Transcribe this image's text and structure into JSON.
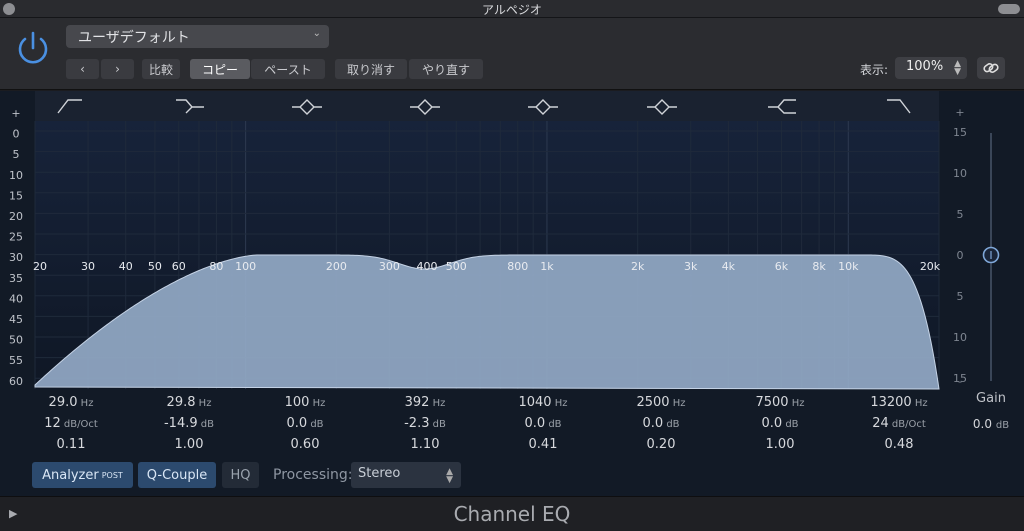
{
  "window": {
    "title": "アルペジオ"
  },
  "header": {
    "preset": "ユーザデフォルト",
    "compare": "比較",
    "copy": "コピー",
    "paste": "ペースト",
    "undo": "取り消す",
    "redo": "やり直す",
    "view_label": "表示:",
    "zoom": "100%"
  },
  "colors": {
    "accent": "#4a90e2",
    "curve_fill": "#93a9c6",
    "background": "#121a26"
  },
  "chart_data": {
    "type": "area",
    "x_scale": "log",
    "x_tick_labels": [
      "20",
      "30",
      "40",
      "50",
      "60",
      "80",
      "100",
      "200",
      "300",
      "400",
      "500",
      "800",
      "1k",
      "2k",
      "3k",
      "4k",
      "6k",
      "8k",
      "10k",
      "20k"
    ],
    "y_tick_labels_left": [
      "+",
      "0",
      "5",
      "10",
      "15",
      "20",
      "25",
      "30",
      "35",
      "40",
      "45",
      "50",
      "55",
      "60",
      "-"
    ],
    "y_tick_labels_right": [
      "+",
      "15",
      "10",
      "5",
      "0",
      "5",
      "10",
      "15",
      "-"
    ]
  },
  "bands": [
    {
      "freq": "29.0",
      "freq_unit": "Hz",
      "gain": "12",
      "gain_unit": "dB/Oct",
      "q": "0.11"
    },
    {
      "freq": "29.8",
      "freq_unit": "Hz",
      "gain": "-14.9",
      "gain_unit": "dB",
      "q": "1.00"
    },
    {
      "freq": "100",
      "freq_unit": "Hz",
      "gain": "0.0",
      "gain_unit": "dB",
      "q": "0.60"
    },
    {
      "freq": "392",
      "freq_unit": "Hz",
      "gain": "-2.3",
      "gain_unit": "dB",
      "q": "1.10"
    },
    {
      "freq": "1040",
      "freq_unit": "Hz",
      "gain": "0.0",
      "gain_unit": "dB",
      "q": "0.41"
    },
    {
      "freq": "2500",
      "freq_unit": "Hz",
      "gain": "0.0",
      "gain_unit": "dB",
      "q": "0.20"
    },
    {
      "freq": "7500",
      "freq_unit": "Hz",
      "gain": "0.0",
      "gain_unit": "dB",
      "q": "1.00"
    },
    {
      "freq": "13200",
      "freq_unit": "Hz",
      "gain": "24",
      "gain_unit": "dB/Oct",
      "q": "0.48"
    }
  ],
  "gain": {
    "label": "Gain",
    "value": "0.0",
    "unit": "dB"
  },
  "bottom": {
    "analyzer": "Analyzer",
    "analyzer_sup": "POST",
    "q_couple": "Q-Couple",
    "hq": "HQ",
    "processing_label": "Processing:",
    "processing_value": "Stereo"
  },
  "footer": {
    "plugin_name": "Channel EQ"
  }
}
